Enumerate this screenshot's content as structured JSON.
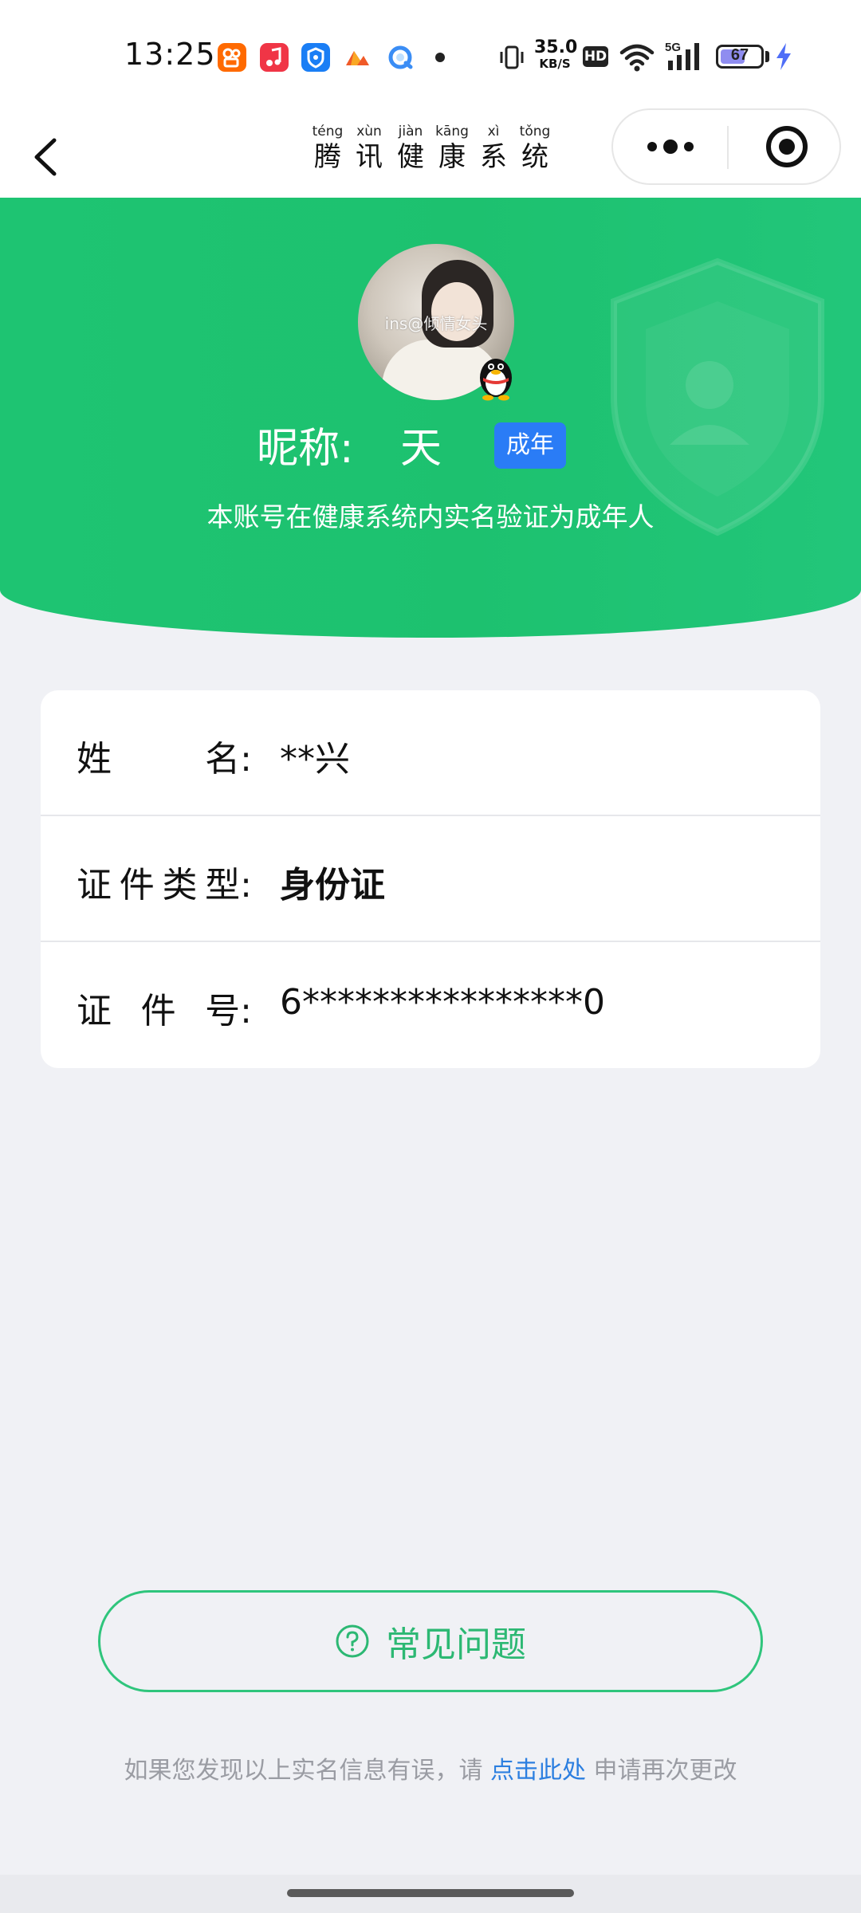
{
  "status_bar": {
    "time": "13:25",
    "net_speed_value": "35.0",
    "net_speed_unit": "KB/S",
    "hd_label": "HD",
    "network_type": "5G",
    "battery_level": "67",
    "battery_fraction": 0.67,
    "app_icons": [
      "kuaishou-app-icon",
      "music-app-icon",
      "security-app-icon",
      "game-app-icon",
      "browser-app-icon"
    ]
  },
  "title_bar": {
    "title_chars": [
      {
        "pinyin": "téng",
        "hanzi": "腾"
      },
      {
        "pinyin": "xùn",
        "hanzi": "讯"
      },
      {
        "pinyin": "jiàn",
        "hanzi": "健"
      },
      {
        "pinyin": "kāng",
        "hanzi": "康"
      },
      {
        "pinyin": "xì",
        "hanzi": "系"
      },
      {
        "pinyin": "tǒng",
        "hanzi": "统"
      }
    ]
  },
  "profile": {
    "avatar_watermark": "ins@倾情女头",
    "nickname_label": "昵称:",
    "nickname_value": "天",
    "age_badge": "成年",
    "verify_text": "本账号在健康系统内实名验证为成年人"
  },
  "info": {
    "rows": [
      {
        "label_chars": [
          "姓",
          "名:"
        ],
        "value": "**兴"
      },
      {
        "label_chars": [
          "证",
          "件",
          "类",
          "型:"
        ],
        "value": "身份证"
      },
      {
        "label_chars": [
          "证",
          "件",
          "号:"
        ],
        "value": "6****************0"
      }
    ]
  },
  "faq": {
    "label": "常见问题"
  },
  "footer": {
    "text_before": "如果您发现以上实名信息有误，请 ",
    "link_text": "点击此处",
    "text_after": " 申请再次更改"
  },
  "colors": {
    "hero_green": "#1ec472",
    "faq_green": "#2cb873",
    "badge_blue": "#2a7cf6",
    "link_blue": "#2c7fe0",
    "background": "#f0f1f5"
  }
}
